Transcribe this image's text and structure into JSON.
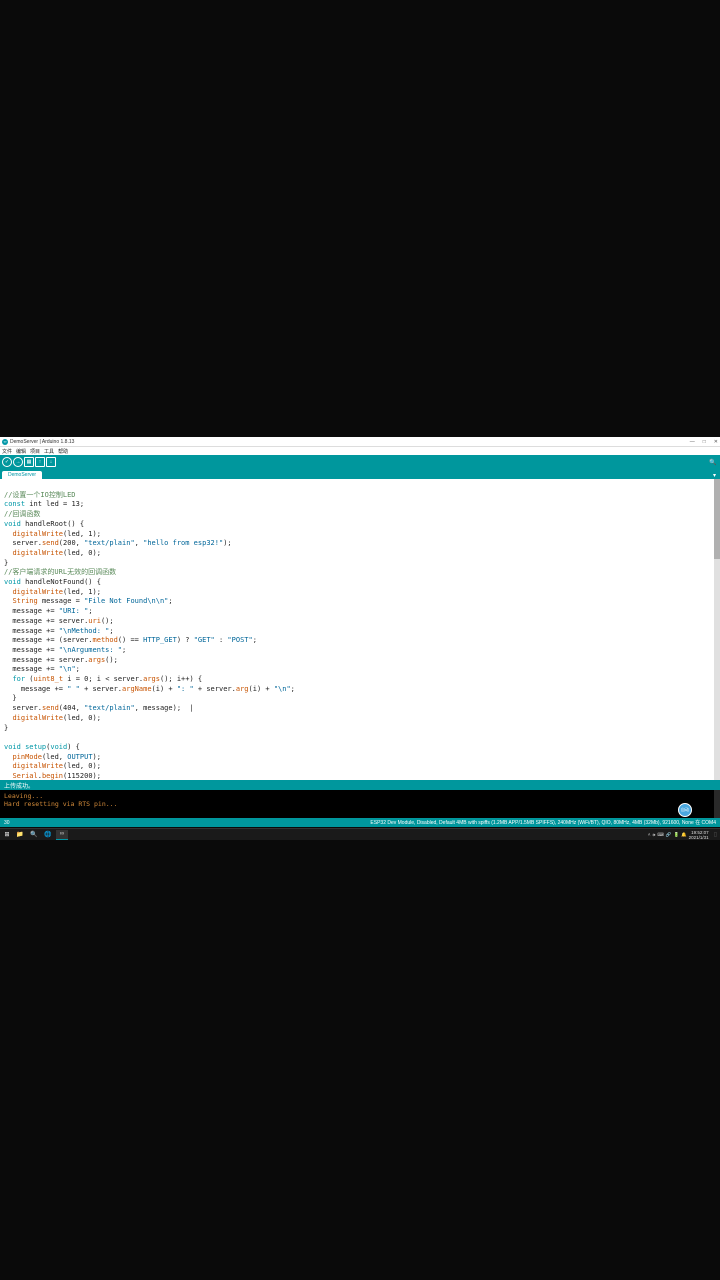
{
  "titlebar": {
    "logo_glyph": "∞",
    "title": "DemoServer | Arduino 1.8.13",
    "min": "—",
    "max": "□",
    "close": "✕"
  },
  "menubar": {
    "items": [
      "文件",
      "编辑",
      "项目",
      "工具",
      "帮助"
    ]
  },
  "toolbar": {
    "verify": "✓",
    "upload": "→",
    "new": "▦",
    "open": "↑",
    "save": "↓",
    "serial": "🔍"
  },
  "tab": {
    "name": "DemoServer",
    "dropdown": "▾"
  },
  "code": {
    "l01_a": "//设置一个IO控制LED",
    "l02_a": "const",
    "l02_b": " int ",
    "l02_c": "led",
    "l02_d": " = 13;",
    "l03_a": "//回调函数",
    "l04_a": "void",
    "l04_b": " handleRoot() {",
    "l05_a": "  ",
    "l05_b": "digitalWrite",
    "l05_c": "(led, 1);",
    "l06_a": "  server.",
    "l06_b": "send",
    "l06_c": "(200, ",
    "l06_d": "\"text/plain\"",
    "l06_e": ", ",
    "l06_f": "\"hello from esp32!\"",
    "l06_g": ");",
    "l07_a": "  ",
    "l07_b": "digitalWrite",
    "l07_c": "(led, 0);",
    "l08_a": "}",
    "l09_a": "//客户端请求的URL无效的回调函数",
    "l10_a": "void",
    "l10_b": " handleNotFound() {",
    "l11_a": "  ",
    "l11_b": "digitalWrite",
    "l11_c": "(led, 1);",
    "l12_a": "  ",
    "l12_b": "String",
    "l12_c": " message = ",
    "l12_d": "\"File Not Found\\n\\n\"",
    "l12_e": ";",
    "l13_a": "  message += ",
    "l13_b": "\"URI: \"",
    "l13_c": ";",
    "l14_a": "  message += server.",
    "l14_b": "uri",
    "l14_c": "();",
    "l15_a": "  message += ",
    "l15_b": "\"\\nMethod: \"",
    "l15_c": ";",
    "l16_a": "  message += (server.",
    "l16_b": "method",
    "l16_c": "() == ",
    "l16_d": "HTTP_GET",
    "l16_e": ") ? ",
    "l16_f": "\"GET\"",
    "l16_g": " : ",
    "l16_h": "\"POST\"",
    "l16_i": ";",
    "l17_a": "  message += ",
    "l17_b": "\"\\nArguments: \"",
    "l17_c": ";",
    "l18_a": "  message += server.",
    "l18_b": "args",
    "l18_c": "();",
    "l19_a": "  message += ",
    "l19_b": "\"\\n\"",
    "l19_c": ";",
    "l20_a": "  ",
    "l20_b": "for",
    "l20_c": " (",
    "l20_d": "uint8_t",
    "l20_e": " i = 0; i < server.",
    "l20_f": "args",
    "l20_g": "(); i++) {",
    "l21_a": "    message += ",
    "l21_b": "\" \"",
    "l21_c": " + server.",
    "l21_d": "argName",
    "l21_e": "(i) + ",
    "l21_f": "\": \"",
    "l21_g": " + server.",
    "l21_h": "arg",
    "l21_i": "(i) + ",
    "l21_j": "\"\\n\"",
    "l21_k": ";",
    "l22_a": "  }",
    "l23_a": "  server.",
    "l23_b": "send",
    "l23_c": "(404, ",
    "l23_d": "\"text/plain\"",
    "l23_e": ", message);  ",
    "l23_f": "|",
    "l24_a": "  ",
    "l24_b": "digitalWrite",
    "l24_c": "(led, 0);",
    "l25_a": "}",
    "l26_a": "",
    "l27_a": "void",
    "l27_b": " ",
    "l27_c": "setup",
    "l27_d": "(",
    "l27_e": "void",
    "l27_f": ") {",
    "l28_a": "  ",
    "l28_b": "pinMode",
    "l28_c": "(led, ",
    "l28_d": "OUTPUT",
    "l28_e": ");",
    "l29_a": "  ",
    "l29_b": "digitalWrite",
    "l29_c": "(led, 0);",
    "l30_a": "  ",
    "l30_b": "Serial",
    "l30_c": ".",
    "l30_d": "begin",
    "l30_e": "(115200);"
  },
  "status": {
    "text": "上传成功。"
  },
  "console": {
    "line1": "Leaving...",
    "line2": "Hard resetting via RTS pin..."
  },
  "footer": {
    "left": "30",
    "right": "ESP32 Dev Module, Disabled, Default 4MB with spiffs (1.2MB APP/1.5MB SPIFFS), 240MHz (WiFi/BT), QIO, 80MHz, 4MB (32Mb), 921600, None 在 COM4"
  },
  "taskbar": {
    "start": "⊞",
    "icons": [
      "📁",
      "🔍",
      "🌐",
      "∞"
    ],
    "tray": [
      "˄",
      "🕪",
      "⌨",
      "🔗",
      "🔋",
      "🔔"
    ],
    "time": "19:52:07",
    "date": "2021/1/31",
    "desktop": "▯"
  },
  "floating": {
    "label": "自动"
  }
}
